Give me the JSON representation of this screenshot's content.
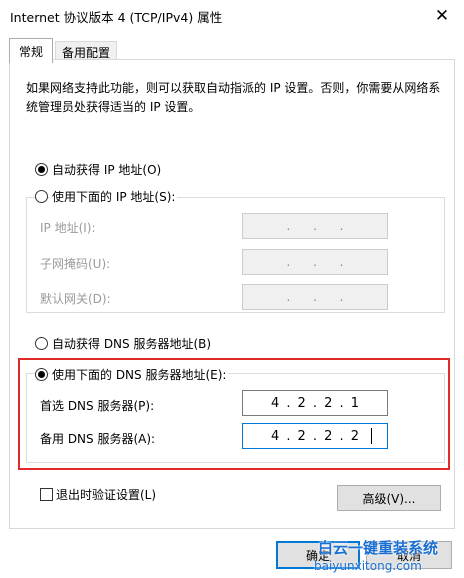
{
  "window": {
    "title": "Internet 协议版本 4 (TCP/IPv4) 属性",
    "close_glyph": "✕"
  },
  "tabs": [
    {
      "label": "常规",
      "active": true
    },
    {
      "label": "备用配置",
      "active": false
    }
  ],
  "description": "如果网络支持此功能，则可以获取自动指派的 IP 设置。否则，你需要从网络系统管理员处获得适当的 IP 设置。",
  "ip": {
    "auto_label": "自动获得 IP 地址(O)",
    "auto_checked": true,
    "manual_label": "使用下面的 IP 地址(S):",
    "manual_checked": false,
    "fields": [
      {
        "label": "IP 地址(I):",
        "value": [
          "",
          "",
          "",
          ""
        ]
      },
      {
        "label": "子网掩码(U):",
        "value": [
          "",
          "",
          "",
          ""
        ]
      },
      {
        "label": "默认网关(D):",
        "value": [
          "",
          "",
          "",
          ""
        ]
      }
    ]
  },
  "dns": {
    "auto_label": "自动获得 DNS 服务器地址(B)",
    "auto_checked": false,
    "manual_label": "使用下面的 DNS 服务器地址(E):",
    "manual_checked": true,
    "preferred_label": "首选 DNS 服务器(P):",
    "preferred_value": [
      "4",
      "2",
      "2",
      "1"
    ],
    "alternate_label": "备用 DNS 服务器(A):",
    "alternate_value": [
      "4",
      "2",
      "2",
      "2"
    ]
  },
  "validate_label": "退出时验证设置(L)",
  "validate_checked": false,
  "advanced_label": "高级(V)...",
  "ok_label": "确定",
  "cancel_label": "取消",
  "watermark": {
    "brand": "白云一键重装系统",
    "url": "baiyunxitong.com"
  },
  "colors": {
    "highlight": "#e02a2a",
    "focus": "#0078d7",
    "watermark": "#1b6fd1"
  }
}
